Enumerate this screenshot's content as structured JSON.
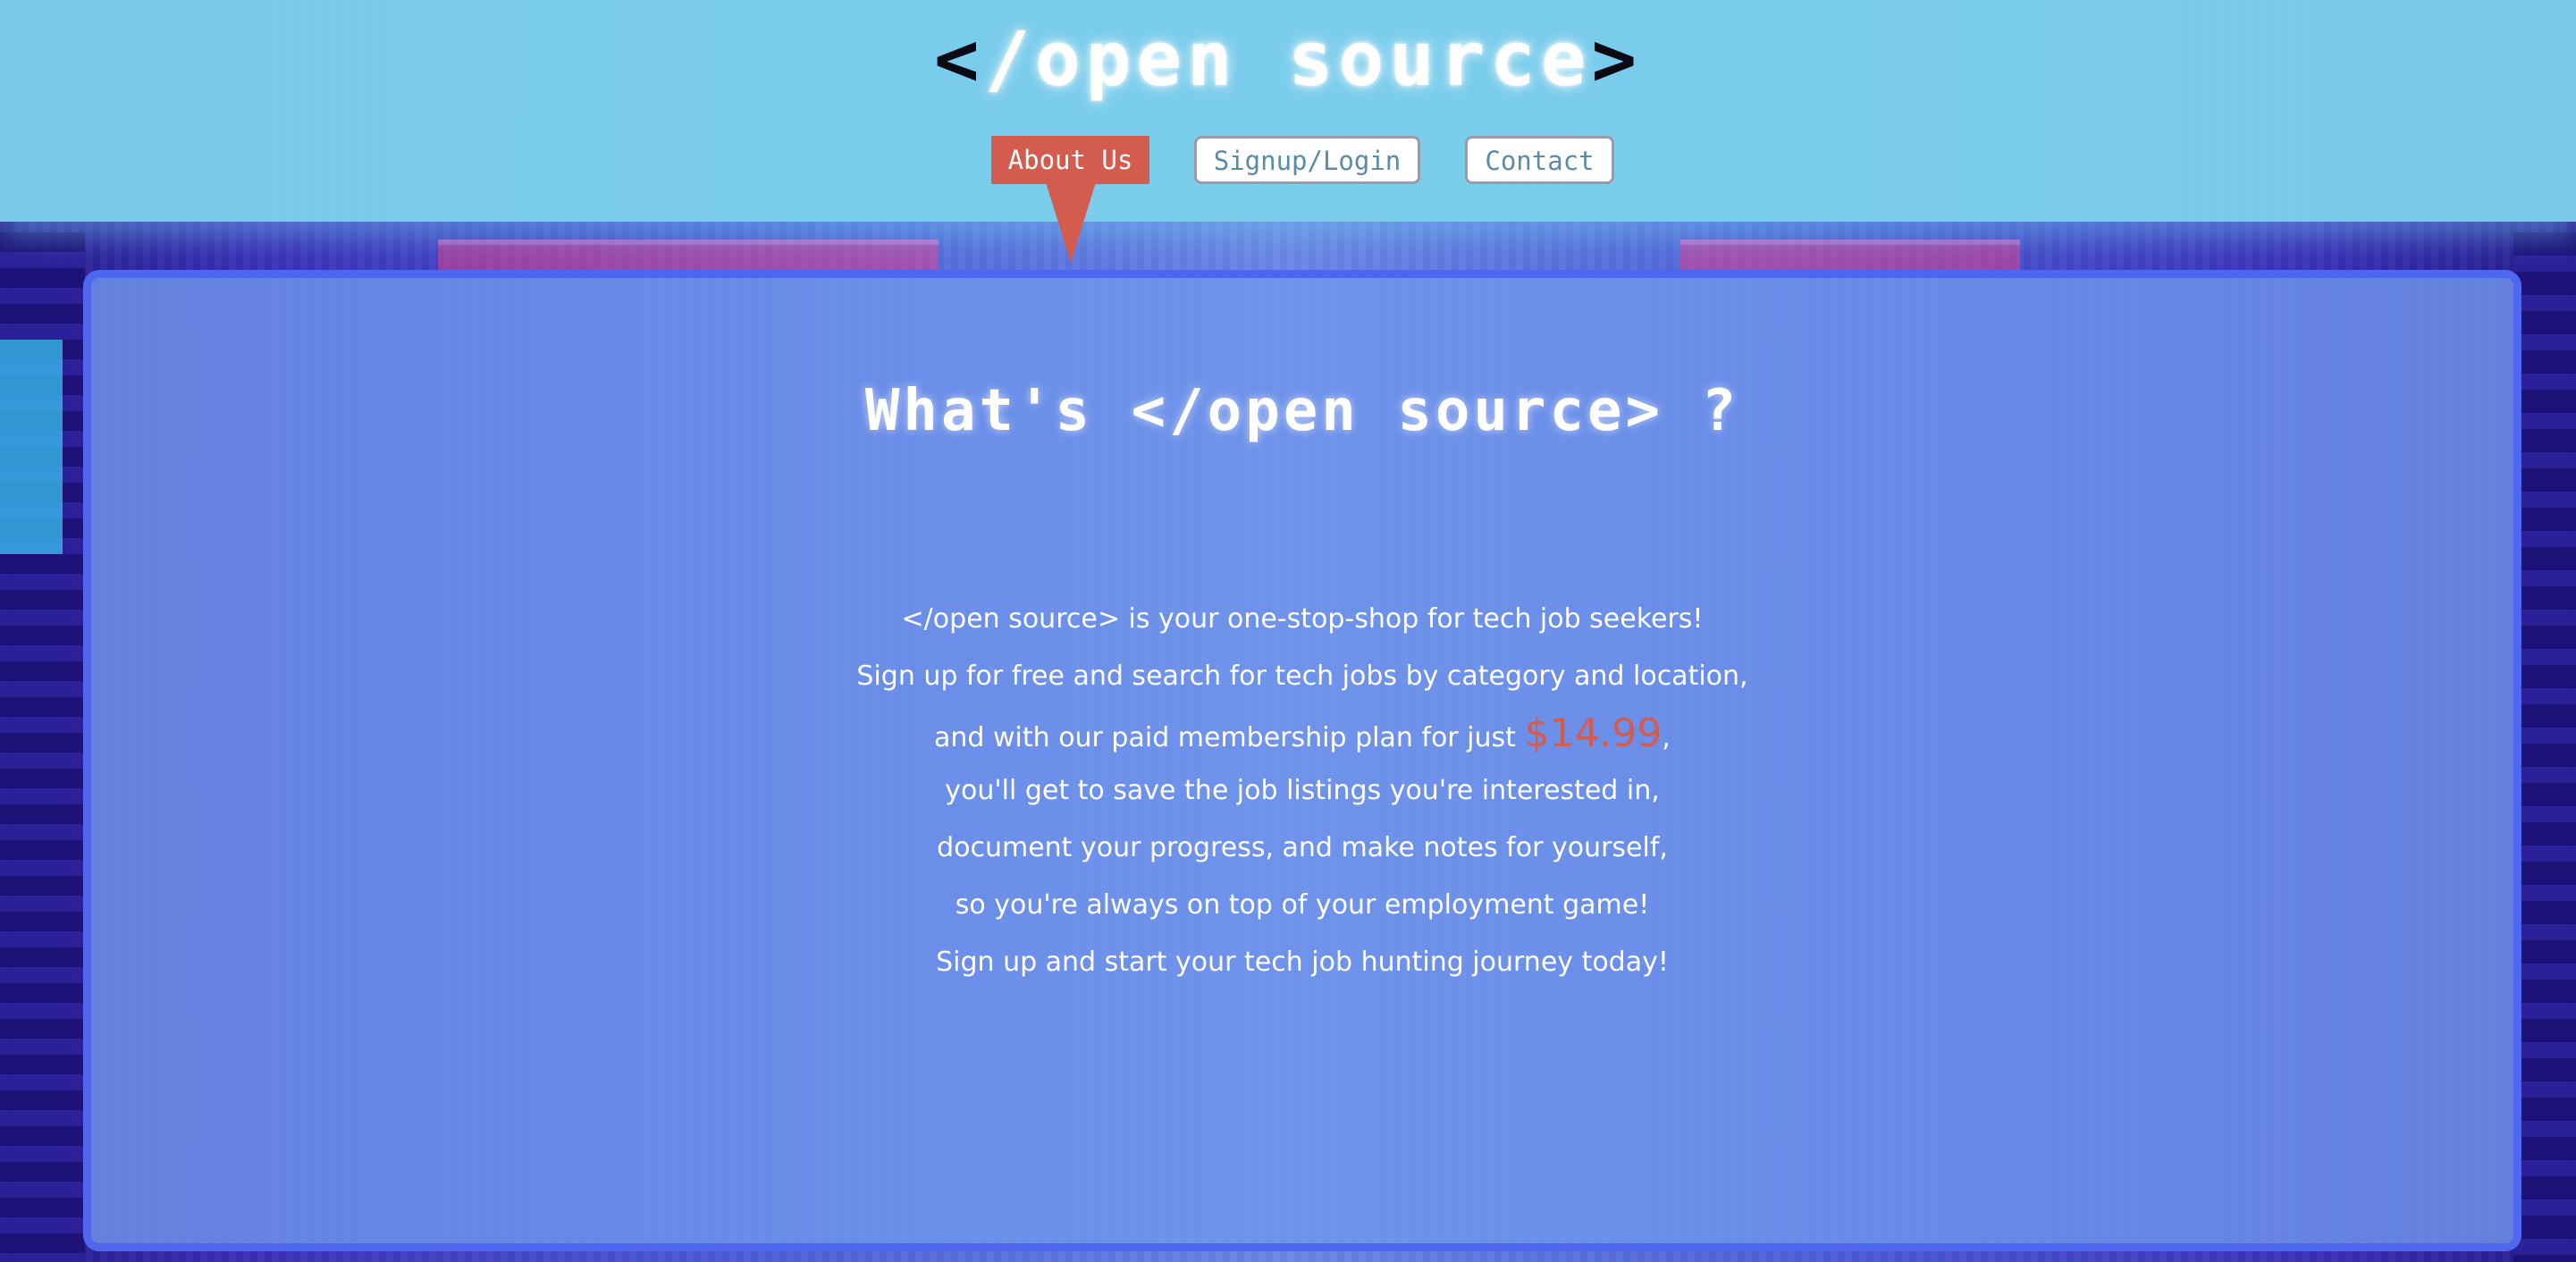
{
  "header": {
    "logo_open": "<",
    "logo_text": "/open source",
    "logo_close": ">"
  },
  "nav": {
    "items": [
      {
        "label": "About Us",
        "active": true
      },
      {
        "label": "Signup/Login",
        "active": false
      },
      {
        "label": "Contact",
        "active": false
      }
    ]
  },
  "main": {
    "title": "What's </open source> ?",
    "lines": [
      "</open source> is your one-stop-shop for tech job seekers!",
      "Sign up for free and search for tech jobs by category and location,",
      "and with our paid membership plan for just ",
      "you'll get to save the job listings you're interested in,",
      "document your progress, and make notes for yourself,",
      "so you're always on top of your employment game!",
      "Sign up and start your tech job hunting journey today!"
    ],
    "price": "$14.99",
    "price_suffix": ","
  },
  "colors": {
    "header_bg": "#7cd0ec",
    "accent": "#d45c4e",
    "panel_border": "#4f67ee",
    "panel_bg": "#7096ec"
  }
}
